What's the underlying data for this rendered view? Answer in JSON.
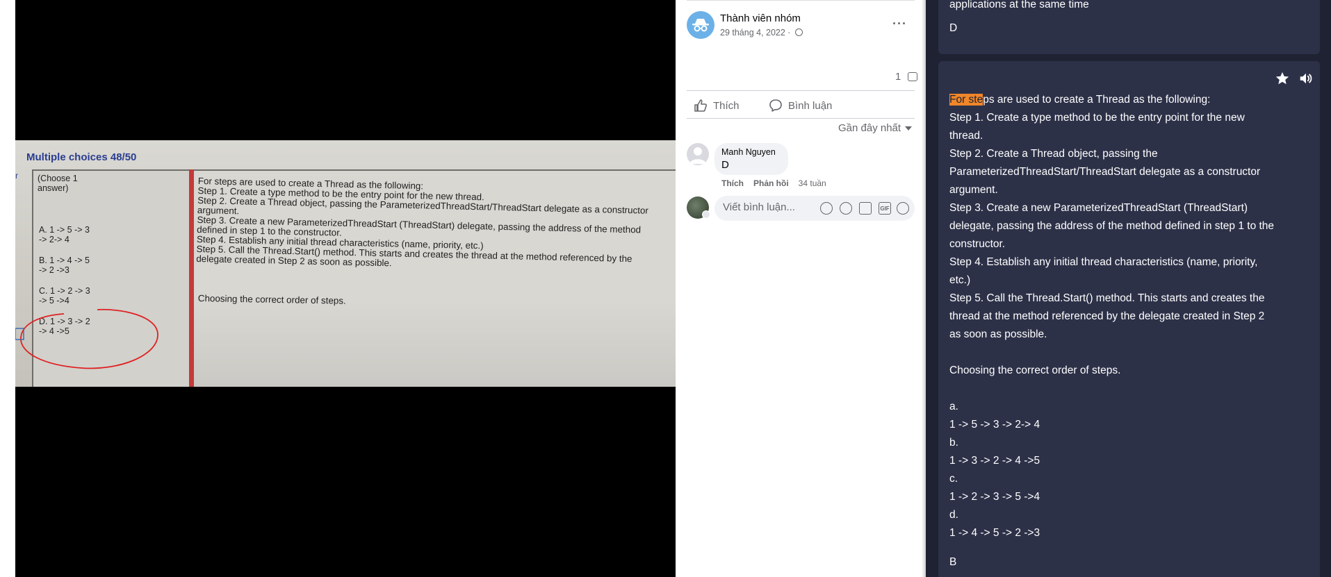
{
  "photo": {
    "header": "Multiple choices 48/50",
    "r_mark": "r",
    "choose": "(Choose 1 answer)",
    "options": [
      {
        "line1": "A.  1 -> 5 -> 3",
        "line2": "-> 2-> 4"
      },
      {
        "line1": "B.  1 -> 4 -> 5",
        "line2": "-> 2 ->3"
      },
      {
        "line1": "C.  1 -> 2 -> 3",
        "line2": "-> 5 ->4"
      },
      {
        "line1": "D.  1 -> 3 -> 2",
        "line2": "-> 4 ->5"
      }
    ],
    "question_lines": [
      "For steps are used to create a Thread as the following:",
      "Step 1. Create a type method to be the entry point for the new thread.",
      "Step 2. Create a Thread object, passing the ParameterizedThreadStart/ThreadStart delegate as a constructor",
      "argument.",
      "Step 3. Create a new ParameterizedThreadStart (ThreadStart) delegate, passing the address of the method",
      "defined in step 1 to the constructor.",
      "Step 4. Establish any initial thread characteristics (name, priority, etc.)",
      "Step 5. Call the Thread.Start() method. This starts and creates the thread at the method referenced by the",
      "delegate created in Step 2 as soon as possible."
    ],
    "choosing": "Choosing the correct order of steps."
  },
  "post": {
    "author": "Thành viên nhóm",
    "date": "29 tháng 4, 2022 · ",
    "comment_count": "1",
    "like_label": "Thích",
    "comment_label": "Bình luận",
    "sort_label": "Gần đây nhất",
    "comment": {
      "name": "Manh Nguyen",
      "text": "D",
      "like": "Thích",
      "reply": "Phản hồi",
      "time": "34 tuần"
    },
    "input_placeholder": "Viết bình luận...",
    "tools": [
      "sticker-icon",
      "emoji-icon",
      "camera-icon",
      "gif-icon",
      "avatar-sticker-icon"
    ]
  },
  "reader": {
    "card1_text": "applications at the same time",
    "card1_answer": "D",
    "highlight": "For ste",
    "first_rest": "ps are used to create a Thread as the following:",
    "lines": [
      "Step 1. Create a type method to be the entry point for the new",
      "thread.",
      "Step 2. Create a Thread object, passing the",
      "ParameterizedThreadStart/ThreadStart delegate as a constructor",
      "argument.",
      "Step 3. Create a new ParameterizedThreadStart (ThreadStart)",
      "delegate, passing the address of the method defined in step 1 to the",
      "constructor.",
      "Step 4. Establish any initial thread characteristics (name, priority,",
      "etc.)",
      "Step 5. Call the Thread.Start() method. This starts and creates the",
      "thread at the method referenced by the delegate created in Step 2",
      "as soon as possible.",
      "",
      "Choosing the correct order of steps.",
      "",
      "a.",
      "1 -> 5 -> 3 -> 2-> 4",
      "b.",
      "1 -> 3 -> 2 -> 4 ->5",
      "c.",
      "1 -> 2 -> 3 -> 5 ->4",
      "d.",
      "1 -> 4 -> 5 -> 2 ->3"
    ],
    "answer": "B",
    "accent": "#f0862a"
  }
}
